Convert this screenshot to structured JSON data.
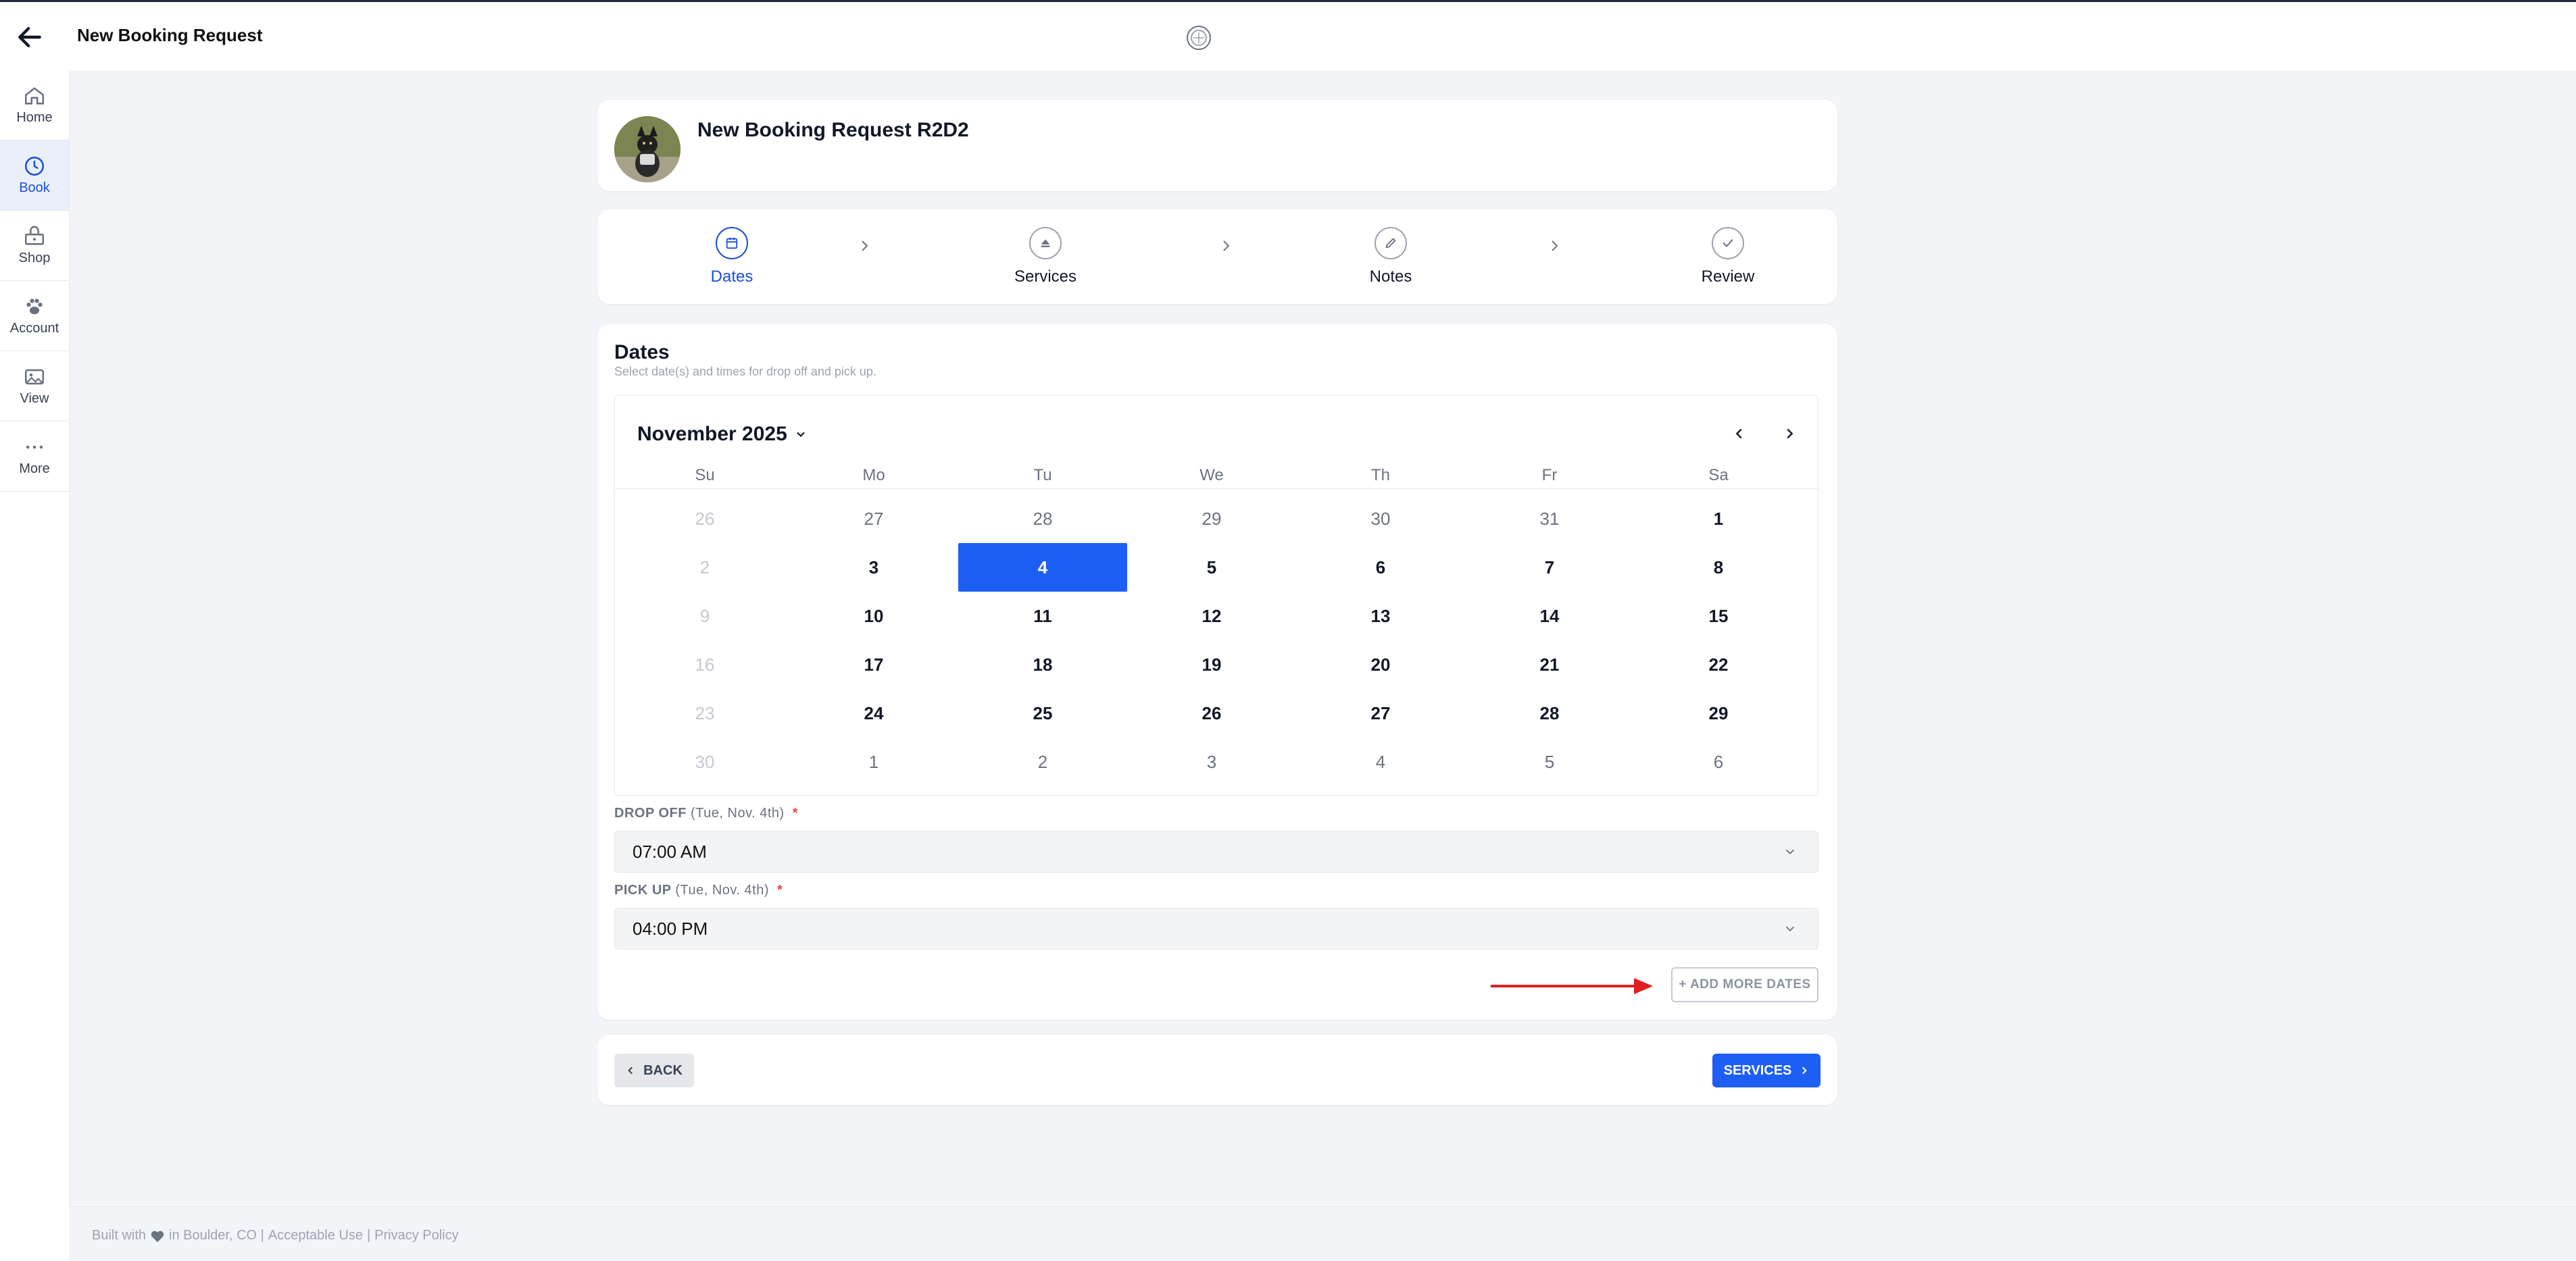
{
  "header": {
    "title": "New Booking Request"
  },
  "sidebar": {
    "items": [
      {
        "label": "Home",
        "icon": "home-icon"
      },
      {
        "label": "Book",
        "icon": "clock-icon",
        "active": true
      },
      {
        "label": "Shop",
        "icon": "shop-icon"
      },
      {
        "label": "Account",
        "icon": "paw-icon"
      },
      {
        "label": "View",
        "icon": "image-icon"
      },
      {
        "label": "More",
        "icon": "more-icon"
      }
    ]
  },
  "booking": {
    "title": "New Booking Request R2D2"
  },
  "steps": [
    {
      "label": "Dates",
      "active": true,
      "icon": "calendar-icon"
    },
    {
      "label": "Services",
      "icon": "eject-icon"
    },
    {
      "label": "Notes",
      "icon": "pencil-icon"
    },
    {
      "label": "Review",
      "icon": "check-icon"
    }
  ],
  "dates": {
    "title": "Dates",
    "subtitle": "Select date(s) and times for drop off and pick up."
  },
  "calendar": {
    "month": "November 2025",
    "weekdays": [
      "Su",
      "Mo",
      "Tu",
      "We",
      "Th",
      "Fr",
      "Sa"
    ],
    "weeks": [
      [
        {
          "d": "26",
          "s": "disabled"
        },
        {
          "d": "27",
          "s": "other"
        },
        {
          "d": "28",
          "s": "other"
        },
        {
          "d": "29",
          "s": "other"
        },
        {
          "d": "30",
          "s": "other"
        },
        {
          "d": "31",
          "s": "other"
        },
        {
          "d": "1",
          "s": ""
        }
      ],
      [
        {
          "d": "2",
          "s": "disabled"
        },
        {
          "d": "3",
          "s": ""
        },
        {
          "d": "4",
          "s": "selected"
        },
        {
          "d": "5",
          "s": ""
        },
        {
          "d": "6",
          "s": ""
        },
        {
          "d": "7",
          "s": ""
        },
        {
          "d": "8",
          "s": ""
        }
      ],
      [
        {
          "d": "9",
          "s": "disabled"
        },
        {
          "d": "10",
          "s": ""
        },
        {
          "d": "11",
          "s": ""
        },
        {
          "d": "12",
          "s": ""
        },
        {
          "d": "13",
          "s": ""
        },
        {
          "d": "14",
          "s": ""
        },
        {
          "d": "15",
          "s": ""
        }
      ],
      [
        {
          "d": "16",
          "s": "disabled"
        },
        {
          "d": "17",
          "s": ""
        },
        {
          "d": "18",
          "s": ""
        },
        {
          "d": "19",
          "s": ""
        },
        {
          "d": "20",
          "s": ""
        },
        {
          "d": "21",
          "s": ""
        },
        {
          "d": "22",
          "s": ""
        }
      ],
      [
        {
          "d": "23",
          "s": "disabled"
        },
        {
          "d": "24",
          "s": ""
        },
        {
          "d": "25",
          "s": ""
        },
        {
          "d": "26",
          "s": ""
        },
        {
          "d": "27",
          "s": ""
        },
        {
          "d": "28",
          "s": ""
        },
        {
          "d": "29",
          "s": ""
        }
      ],
      [
        {
          "d": "30",
          "s": "disabled"
        },
        {
          "d": "1",
          "s": "other"
        },
        {
          "d": "2",
          "s": "other"
        },
        {
          "d": "3",
          "s": "other"
        },
        {
          "d": "4",
          "s": "other"
        },
        {
          "d": "5",
          "s": "other"
        },
        {
          "d": "6",
          "s": "other"
        }
      ]
    ]
  },
  "dropoff": {
    "label": "DROP OFF",
    "date": "(Tue, Nov. 4th)",
    "required": "*",
    "value": "07:00 AM"
  },
  "pickup": {
    "label": "PICK UP",
    "date": "(Tue, Nov. 4th)",
    "required": "*",
    "value": "04:00 PM"
  },
  "add_more_dates": "+ ADD MORE DATES",
  "nav": {
    "back": "BACK",
    "next": "SERVICES"
  },
  "footer": {
    "built_with": "Built with",
    "location": "in Boulder, CO |",
    "acceptable_use": "Acceptable Use",
    "sep": "|",
    "privacy": "Privacy Policy"
  },
  "colors": {
    "accent": "#1d5ef5",
    "annotation_arrow": "#e02020",
    "required": "#ef4444"
  }
}
